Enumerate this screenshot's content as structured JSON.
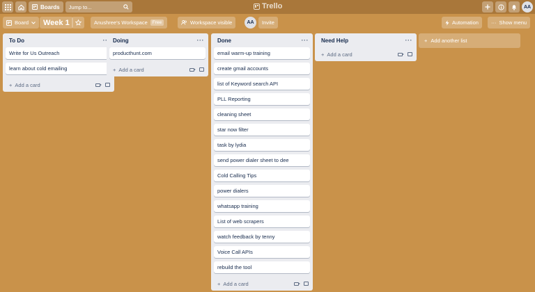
{
  "topnav": {
    "boards_label": "Boards",
    "search_placeholder": "Jump to...",
    "logo_text": "Trello",
    "avatar_initials": "AA"
  },
  "board_header": {
    "view_label": "Board",
    "title": "Week 1",
    "workspace_label": "Anushree's Workspace",
    "workspace_badge": "Free",
    "visibility_label": "Workspace visible",
    "member_initials": "AA",
    "invite_label": "Invite",
    "automation_label": "Automation",
    "show_menu_label": "Show menu"
  },
  "lists": [
    {
      "title": "To Do",
      "cards": [
        "Write for Us Outreach",
        "learn about cold emailing"
      ],
      "add_label": "Add a card"
    },
    {
      "title": "Doing",
      "cards": [
        "producthunt.com"
      ],
      "add_label": "Add a card"
    },
    {
      "title": "Done",
      "cards": [
        "email warm-up training",
        "create gmail accounts",
        "list of Keyword search API",
        "PLL Reporting",
        "cleaning sheet",
        "star now filter",
        "task by lydia",
        "send power dialer sheet to dee",
        "Cold Calling Tips",
        "power dialers",
        "whatsapp training",
        "List of web scrapers",
        "watch feedback by tenny",
        "Voice Call APIs",
        "rebuild the tool"
      ],
      "add_label": "Add a card"
    },
    {
      "title": "Need Help",
      "cards": [],
      "add_label": "Add a card"
    }
  ],
  "add_list_label": "Add another list",
  "colors": {
    "board_bg": "#c9924a",
    "nav_bg": "#a9773a",
    "list_bg": "#ebecf0"
  }
}
